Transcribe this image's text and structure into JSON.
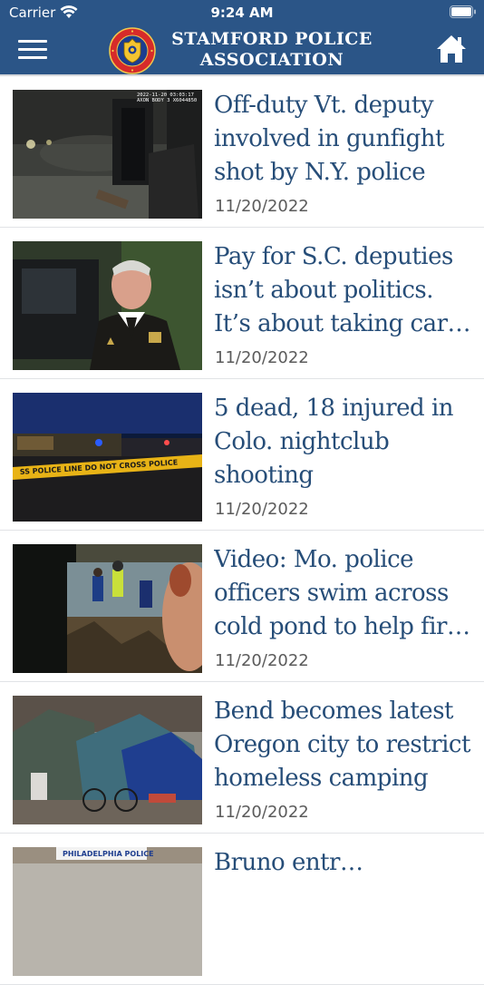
{
  "status": {
    "carrier": "Carrier",
    "time": "9:24 AM"
  },
  "header": {
    "title_line1": "STAMFORD POLICE",
    "title_line2": "ASSOCIATION",
    "logo_icon": "police-badge-logo",
    "menu_icon": "hamburger-menu-icon",
    "home_icon": "home-icon",
    "color": "#2b5587"
  },
  "articles": [
    {
      "line1": "Off-duty Vt. deputy",
      "line2": "involved in gunfight",
      "line3": "shot by N.Y. police",
      "date": "11/20/2022",
      "image": "bodycam-night-scene",
      "overlay": "2022-11-20 03:03:17 AXON BODY 3 X6044850"
    },
    {
      "line1": "Pay for S.C. deputies",
      "line2": "isn’t about politics.",
      "line3": "It’s about taking car…",
      "date": "11/20/2022",
      "image": "sheriff-portrait"
    },
    {
      "line1": "5 dead, 18 injured in",
      "line2": "Colo. nightclub",
      "line3": "shooting",
      "date": "11/20/2022",
      "image": "police-tape-night",
      "overlay": "POLICE LINE DO NOT CROSS"
    },
    {
      "line1": "Video: Mo. police",
      "line2": "officers swim across",
      "line3": "cold pond to help fir…",
      "date": "11/20/2022",
      "image": "pond-rescue-bodycam"
    },
    {
      "line1": "Bend becomes latest",
      "line2": "Oregon city to restrict",
      "line3": "homeless camping",
      "date": "11/20/2022",
      "image": "homeless-camp-tents"
    },
    {
      "line1": "Bruno entr…",
      "image": "philadelphia-police-sign",
      "overlay": "PHILADELPHIA POLICE"
    }
  ]
}
